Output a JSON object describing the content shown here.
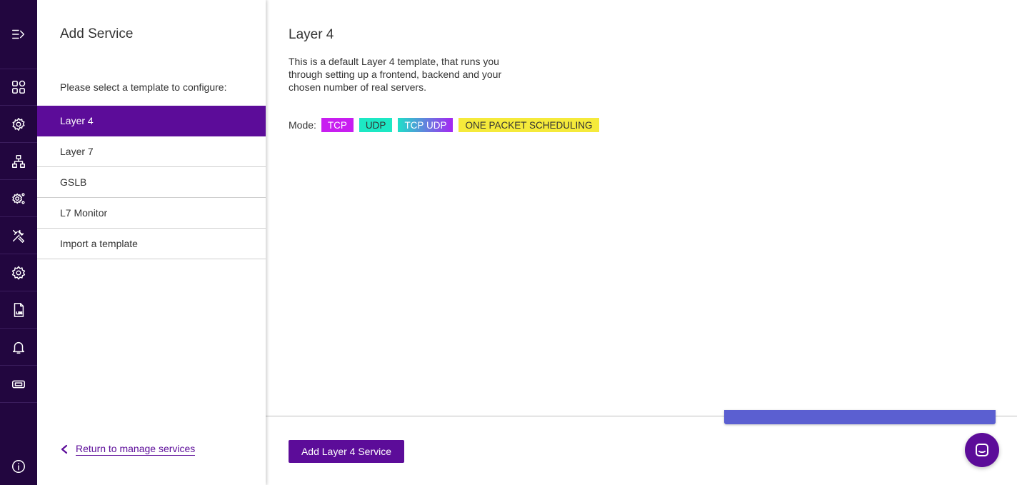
{
  "rail": {
    "icons": [
      "expand-menu-icon",
      "dashboard-icon",
      "services-cog-icon",
      "network-icon",
      "advanced-settings-icon",
      "tools-icon",
      "settings-icon",
      "log-file-icon",
      "notifications-bell-icon",
      "ticket-icon",
      "info-icon"
    ]
  },
  "left_panel": {
    "title": "Add Service",
    "prompt": "Please select a template to configure:",
    "templates": [
      {
        "label": "Layer 4"
      },
      {
        "label": "Layer 7"
      },
      {
        "label": "GSLB"
      },
      {
        "label": "L7 Monitor"
      },
      {
        "label": "Import a template"
      }
    ],
    "return_link": "Return to manage services"
  },
  "main": {
    "title": "Layer 4",
    "description": "This is a default Layer 4 template, that runs you through setting up a frontend, backend and your chosen number of real servers.",
    "mode_label": "Mode:",
    "modes": [
      {
        "label": "TCP",
        "color": "#c81ef0"
      },
      {
        "label": "UDP",
        "color": "#1de8c4"
      },
      {
        "label": "TCP UDP",
        "color": "gradient"
      },
      {
        "label": "ONE PACKET SCHEDULING",
        "color": "#f5ea3b"
      }
    ],
    "add_button": "Add Layer 4 Service"
  },
  "colors": {
    "accent": "#5c0c99",
    "rail_bg": "#22063f",
    "banner": "#5b5fd1"
  }
}
